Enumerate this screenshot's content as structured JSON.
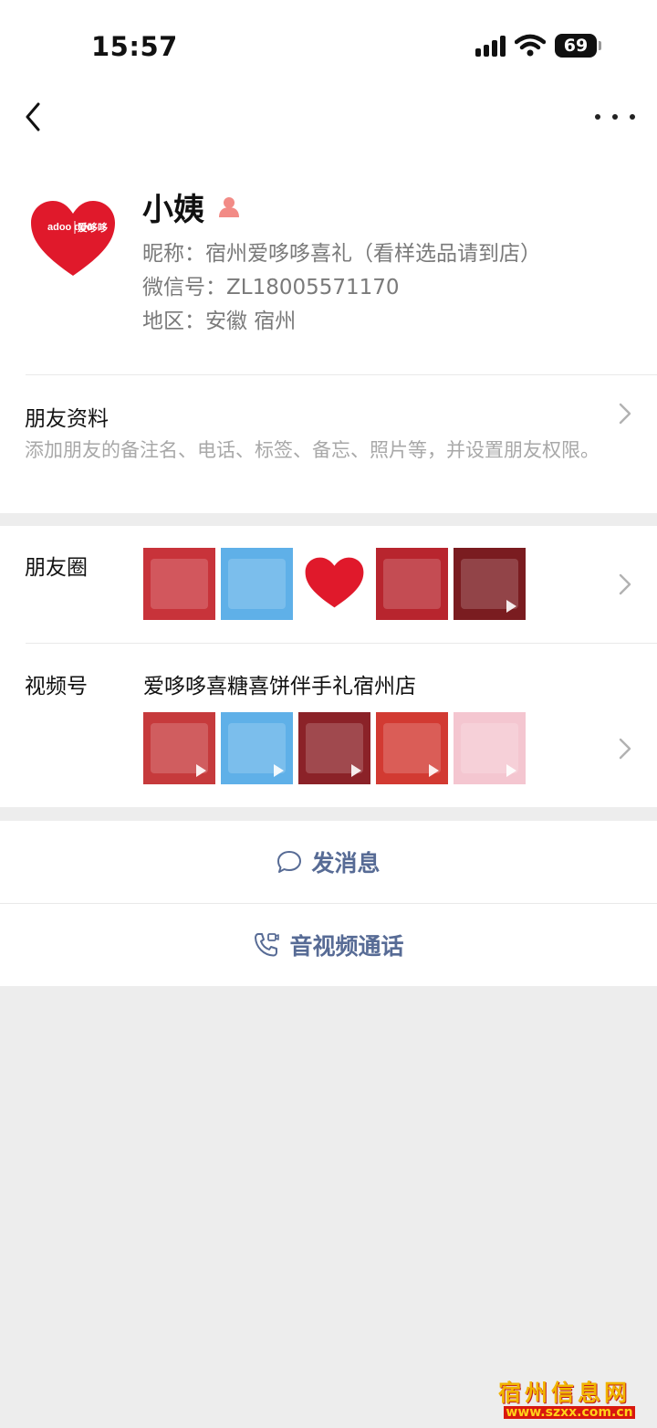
{
  "status_bar": {
    "time": "15:57",
    "battery": "69"
  },
  "profile": {
    "name": "小姨",
    "nickname": "昵称：宿州爱哆哆喜礼（看样选品请到店）",
    "wechat_id": "微信号：ZL18005571170",
    "region": "地区：安徽 宿州",
    "avatar_brand": "adoo doo",
    "avatar_brand_cn": "爱哆哆"
  },
  "friend_info": {
    "title": "朋友资料",
    "description": "添加朋友的备注名、电话、标签、备忘、照片等，并设置朋友权限。"
  },
  "moments": {
    "title": "朋友圈",
    "thumbs": [
      {
        "name": "gift-box-photo",
        "bg": "#c8333a"
      },
      {
        "name": "childrens-day-photo",
        "bg": "#5fb0e8"
      },
      {
        "name": "logo-photo",
        "bg": "#ffffff"
      },
      {
        "name": "new-product-photo",
        "bg": "#b8252e"
      },
      {
        "name": "video-photo",
        "bg": "#7a1c20"
      }
    ]
  },
  "channels": {
    "title": "视频号",
    "name": "爱哆哆喜糖喜饼伴手礼宿州店",
    "thumbs": [
      {
        "name": "presenter-video",
        "bg": "#c63a3c"
      },
      {
        "name": "childrens-day-video",
        "bg": "#5fb0e8"
      },
      {
        "name": "gift-box-video",
        "bg": "#8b2228"
      },
      {
        "name": "frame-video",
        "bg": "#d23a32"
      },
      {
        "name": "little-princess-video",
        "bg": "#f4c6d0"
      }
    ]
  },
  "actions": {
    "message": "发消息",
    "call": "音视频通话"
  },
  "watermark": {
    "top": "宿州信息网",
    "bottom": "www.szxx.com.cn"
  },
  "colors": {
    "link": "#576b95",
    "brand_red": "#e0192b"
  }
}
